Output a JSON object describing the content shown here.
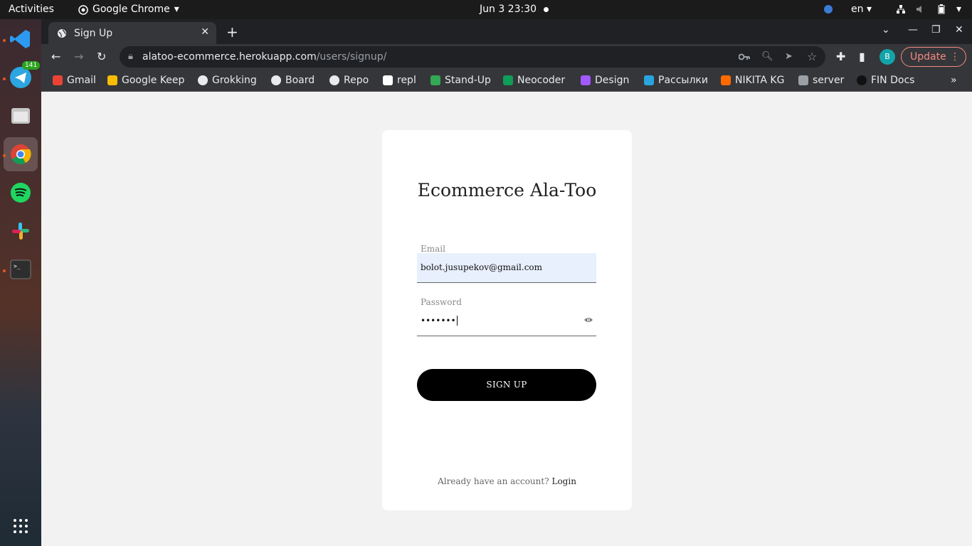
{
  "topbar": {
    "activities": "Activities",
    "app_name": "Google Chrome",
    "clock": "Jun 3  23:30",
    "lang": "en"
  },
  "dock": {
    "telegram_badge": "141",
    "items": [
      "vscode-icon",
      "telegram-icon",
      "files-icon",
      "chrome-icon",
      "spotify-icon",
      "slack-icon",
      "terminal-icon",
      "apps-grid-icon"
    ]
  },
  "browser": {
    "tab_title": "Sign Up",
    "url_host": "alatoo-ecommerce.herokuapp.com",
    "url_path": "/users/signup/",
    "profile_initial": "B",
    "update_label": "Update",
    "bookmarks": [
      "Gmail",
      "Google Keep",
      "Grokking",
      "Board",
      "Repo",
      "repl",
      "Stand-Up",
      "Neocoder",
      "Design",
      "Рассылки",
      "NIKITA KG",
      "server",
      "FIN Docs"
    ]
  },
  "page": {
    "title": "Ecommerce Ala-Too",
    "email_label": "Email",
    "email_value": "bolot.jusupekov@gmail.com",
    "password_label": "Password",
    "password_value": "•••••••",
    "signup_label": "SIGN UP",
    "footer_text": "Already have an account?",
    "login_link": "Login"
  },
  "colors": {
    "accent": "#000000",
    "autofill": "#e8f0fe",
    "update": "#f28b82",
    "avatar": "#12a4a8"
  }
}
